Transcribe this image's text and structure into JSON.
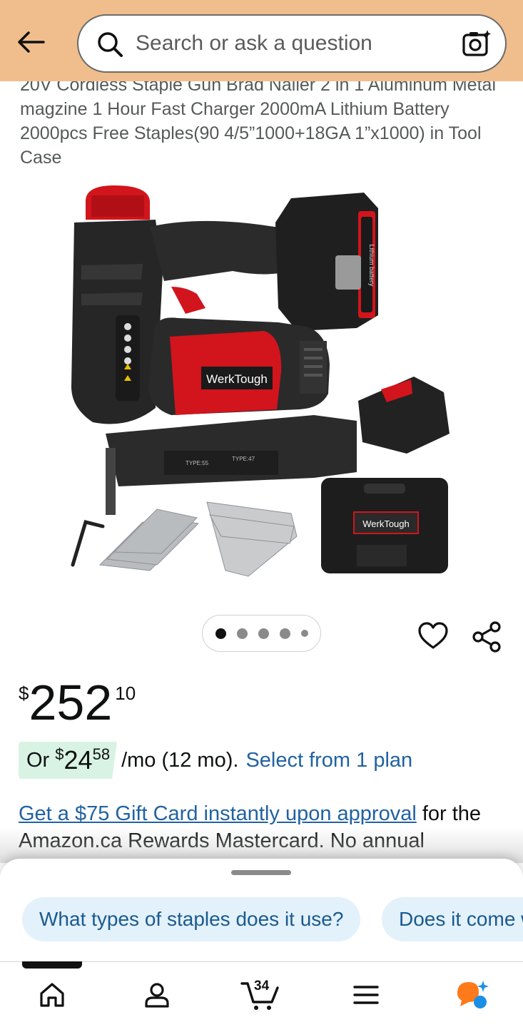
{
  "header": {
    "search_placeholder": "Search or ask a question"
  },
  "product": {
    "title": "20V Cordless Staple Gun Brad Nailer 2 in 1 Aluminum Metal magzine 1 Hour Fast Charger 2000mA Lithium Battery 2000pcs Free Staples(90 4/5”1000+18GA 1”x1000) in Tool Case",
    "brand_label": "WerkTough",
    "battery_label": "Lithium battery",
    "magazine_labels": [
      "TYPE:55",
      "TYPE:47"
    ]
  },
  "carousel": {
    "dots": [
      "active",
      "inactive",
      "inactive",
      "inactive",
      "small"
    ]
  },
  "price": {
    "currency": "$",
    "whole": "252",
    "fraction": "10"
  },
  "installment": {
    "prefix": "Or",
    "currency": "$",
    "whole": "24",
    "fraction": "58",
    "terms": "/mo (12 mo).",
    "link": "Select from 1 plan"
  },
  "gift_card": {
    "link": "Get a $75 Gift Card instantly upon approval",
    "text": " for the Amazon.ca Rewards Mastercard. No annual"
  },
  "suggestions": [
    "What types of staples does it use?",
    "Does it come with a battery?"
  ],
  "nav": {
    "items": [
      "home-icon",
      "account-icon",
      "cart-icon",
      "menu-icon",
      "rufus-icon"
    ],
    "cart_count": "34"
  },
  "colors": {
    "header_bg": "#f0be8c",
    "link": "#2162a1",
    "deal_pill": "#d8f3e4",
    "chip_bg": "#e3f1fb",
    "brand_red": "#d2141c"
  }
}
